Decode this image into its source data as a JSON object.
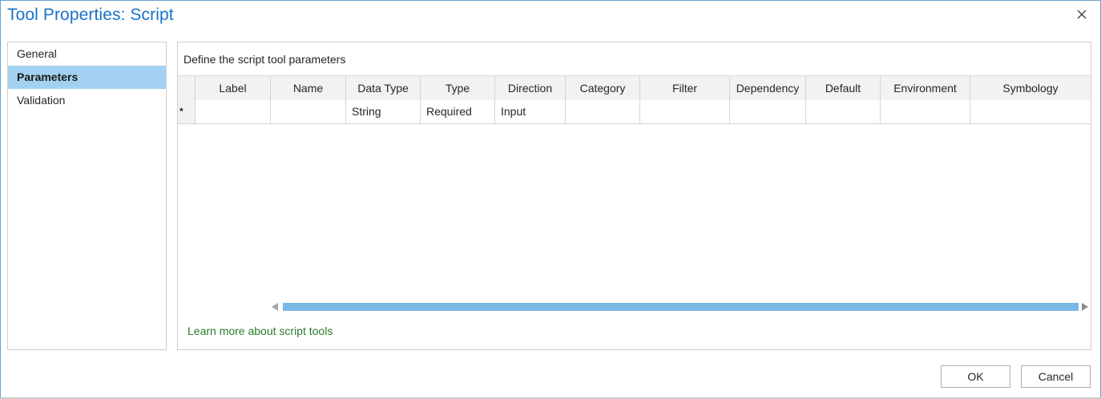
{
  "window": {
    "title": "Tool Properties: Script"
  },
  "nav": {
    "items": [
      {
        "label": "General",
        "selected": false
      },
      {
        "label": "Parameters",
        "selected": true
      },
      {
        "label": "Validation",
        "selected": false
      }
    ]
  },
  "panel": {
    "heading": "Define the script tool parameters",
    "columns": [
      "",
      "Label",
      "Name",
      "Data Type",
      "Type",
      "Direction",
      "Category",
      "Filter",
      "Dependency",
      "Default",
      "Environment",
      "Symbology"
    ],
    "new_row": {
      "marker": "*",
      "label": "",
      "name": "",
      "data_type": "String",
      "type": "Required",
      "direction": "Input",
      "category": "",
      "filter": "",
      "dependency": "",
      "default": "",
      "environment": "",
      "symbology": ""
    },
    "learn_more": "Learn more about script tools"
  },
  "footer": {
    "ok_label": "OK",
    "cancel_label": "Cancel"
  },
  "icons": {
    "close": "close-icon",
    "scroll_left": "scroll-left-arrow-icon",
    "scroll_right": "scroll-right-arrow-icon"
  },
  "colors": {
    "title": "#1873c7",
    "selected_nav": "#a4d1f2",
    "scroll_thumb": "#7ab8e4",
    "link": "#2a7a2a"
  }
}
